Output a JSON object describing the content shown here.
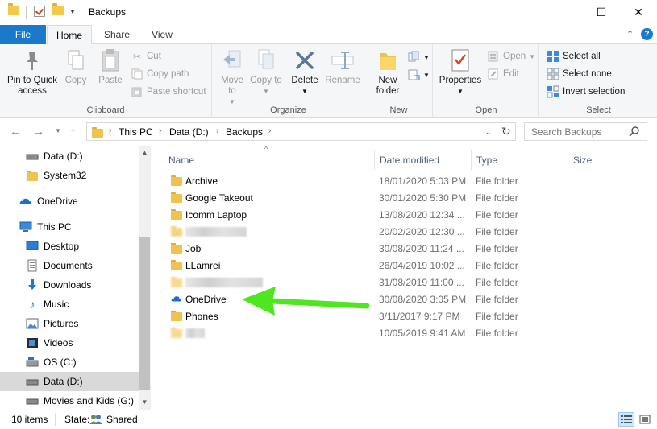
{
  "window": {
    "title": "Backups",
    "minimize_glyph": "—",
    "maximize_glyph": "☐",
    "close_glyph": "✕"
  },
  "ribbon_tabs": {
    "file": "File",
    "home": "Home",
    "share": "Share",
    "view": "View"
  },
  "ribbon": {
    "clipboard": {
      "label": "Clipboard",
      "pin": "Pin to Quick access",
      "copy": "Copy",
      "paste": "Paste",
      "cut": "Cut",
      "copy_path": "Copy path",
      "paste_shortcut": "Paste shortcut"
    },
    "organize": {
      "label": "Organize",
      "move_to": "Move to",
      "copy_to": "Copy to",
      "delete": "Delete",
      "rename": "Rename"
    },
    "new": {
      "label": "New",
      "new_folder": "New folder"
    },
    "open": {
      "label": "Open",
      "properties": "Properties",
      "open": "Open",
      "edit": "Edit"
    },
    "select": {
      "label": "Select",
      "select_all": "Select all",
      "select_none": "Select none",
      "invert": "Invert selection"
    }
  },
  "address": {
    "crumbs": [
      "This PC",
      "Data (D:)",
      "Backups"
    ],
    "search_placeholder": "Search Backups"
  },
  "nav_pane": {
    "items": [
      {
        "label": "Data (D:)",
        "icon": "drive-icon"
      },
      {
        "label": "System32",
        "icon": "folder-icon"
      },
      {
        "label": "OneDrive",
        "icon": "cloud-icon"
      },
      {
        "label": "This PC",
        "icon": "computer-icon"
      },
      {
        "label": "Desktop",
        "icon": "desktop-icon"
      },
      {
        "label": "Documents",
        "icon": "documents-icon"
      },
      {
        "label": "Downloads",
        "icon": "download-icon"
      },
      {
        "label": "Music",
        "icon": "music-icon"
      },
      {
        "label": "Pictures",
        "icon": "pictures-icon"
      },
      {
        "label": "Videos",
        "icon": "videos-icon"
      },
      {
        "label": "OS (C:)",
        "icon": "os-drive-icon"
      },
      {
        "label": "Data (D:)",
        "icon": "drive-icon"
      },
      {
        "label": "Movies and Kids (G:)",
        "icon": "drive-icon"
      }
    ]
  },
  "columns": {
    "name": "Name",
    "date": "Date modified",
    "type": "Type",
    "size": "Size"
  },
  "files": [
    {
      "name": "Archive",
      "date": "18/01/2020 5:03 PM",
      "type": "File folder"
    },
    {
      "name": "Google Takeout",
      "date": "30/01/2020 5:30 PM",
      "type": "File folder"
    },
    {
      "name": "Icomm Laptop",
      "date": "13/08/2020 12:34 ...",
      "type": "File folder"
    },
    {
      "name": "",
      "date": "20/02/2020 12:30 ...",
      "type": "File folder"
    },
    {
      "name": "Job",
      "date": "30/08/2020 11:24 ...",
      "type": "File folder"
    },
    {
      "name": "LLamrei",
      "date": "26/04/2019 10:02 ...",
      "type": "File folder"
    },
    {
      "name": "",
      "date": "31/08/2019 11:00 ...",
      "type": "File folder"
    },
    {
      "name": "OneDrive",
      "date": "30/08/2020 3:05 PM",
      "type": "File folder"
    },
    {
      "name": "Phones",
      "date": "3/11/2017 9:17 PM",
      "type": "File folder"
    },
    {
      "name": "",
      "date": "10/05/2019 9:41 AM",
      "type": "File folder"
    }
  ],
  "status": {
    "count": "10 items",
    "state_label": "State:",
    "state_value": "Shared"
  },
  "colors": {
    "accent": "#1979ca",
    "folder": "#f0c34e",
    "arrow": "#4de61f"
  }
}
